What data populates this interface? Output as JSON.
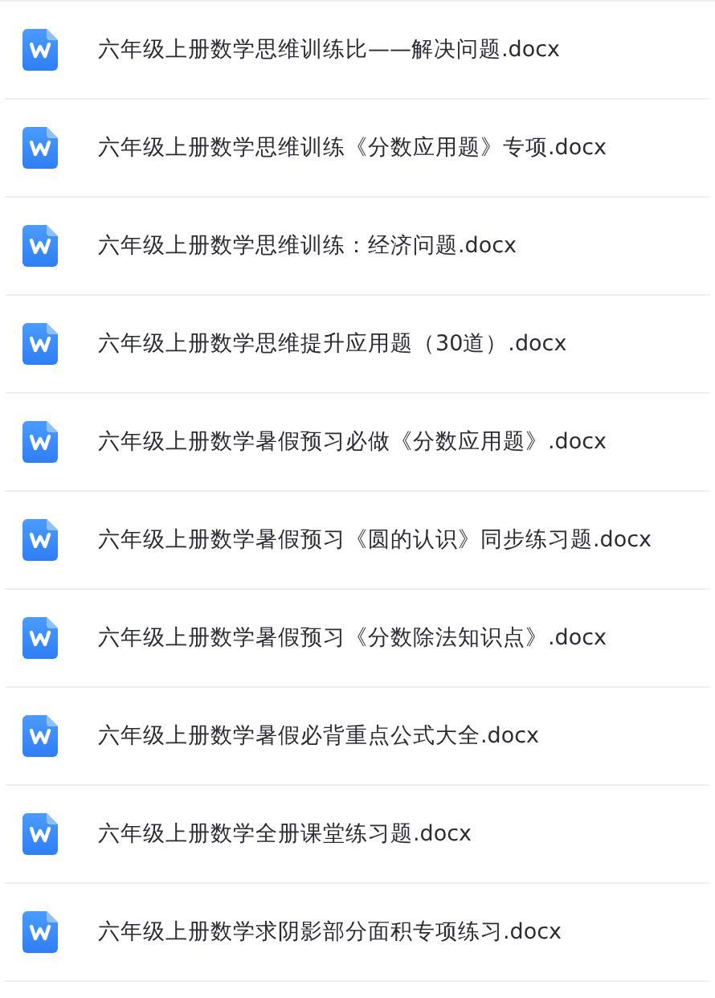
{
  "files": [
    {
      "name": "六年级上册数学思维训练比——解决问题.docx"
    },
    {
      "name": "六年级上册数学思维训练《分数应用题》专项.docx"
    },
    {
      "name": "六年级上册数学思维训练：经济问题.docx"
    },
    {
      "name": "六年级上册数学思维提升应用题（30道）.docx"
    },
    {
      "name": "六年级上册数学暑假预习必做《分数应用题》.docx"
    },
    {
      "name": "六年级上册数学暑假预习《圆的认识》同步练习题.docx"
    },
    {
      "name": "六年级上册数学暑假预习《分数除法知识点》.docx"
    },
    {
      "name": "六年级上册数学暑假必背重点公式大全.docx"
    },
    {
      "name": "六年级上册数学全册课堂练习题.docx"
    },
    {
      "name": "六年级上册数学求阴影部分面积专项练习.docx"
    }
  ]
}
